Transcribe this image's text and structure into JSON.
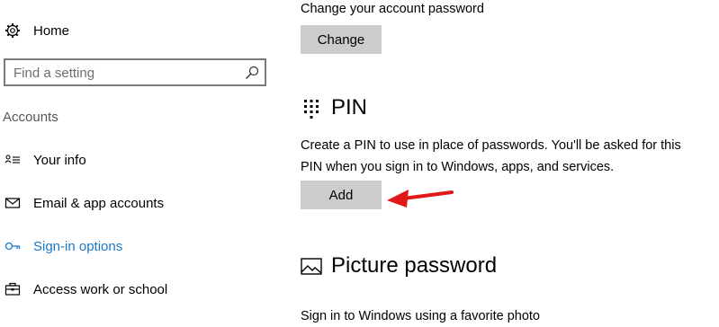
{
  "sidebar": {
    "home_label": "Home",
    "search": {
      "placeholder": "Find a setting"
    },
    "group_label": "Accounts",
    "items": [
      {
        "label": "Your info",
        "icon": "person-card-icon"
      },
      {
        "label": "Email & app accounts",
        "icon": "mail-icon"
      },
      {
        "label": "Sign-in options",
        "icon": "key-icon",
        "active": true
      },
      {
        "label": "Access work or school",
        "icon": "briefcase-icon"
      }
    ]
  },
  "main": {
    "password": {
      "description": "Change your account password",
      "button_label": "Change"
    },
    "pin": {
      "title": "PIN",
      "description_line1": "Create a PIN to use in place of passwords. You'll be asked for this",
      "description_line2": "PIN when you sign in to Windows, apps, and services.",
      "button_label": "Add"
    },
    "picture_password": {
      "title": "Picture password",
      "description": "Sign in to Windows using a favorite photo"
    }
  },
  "colors": {
    "accent": "#1979ca",
    "button_bg": "#cccccc",
    "arrow": "#e01818"
  }
}
